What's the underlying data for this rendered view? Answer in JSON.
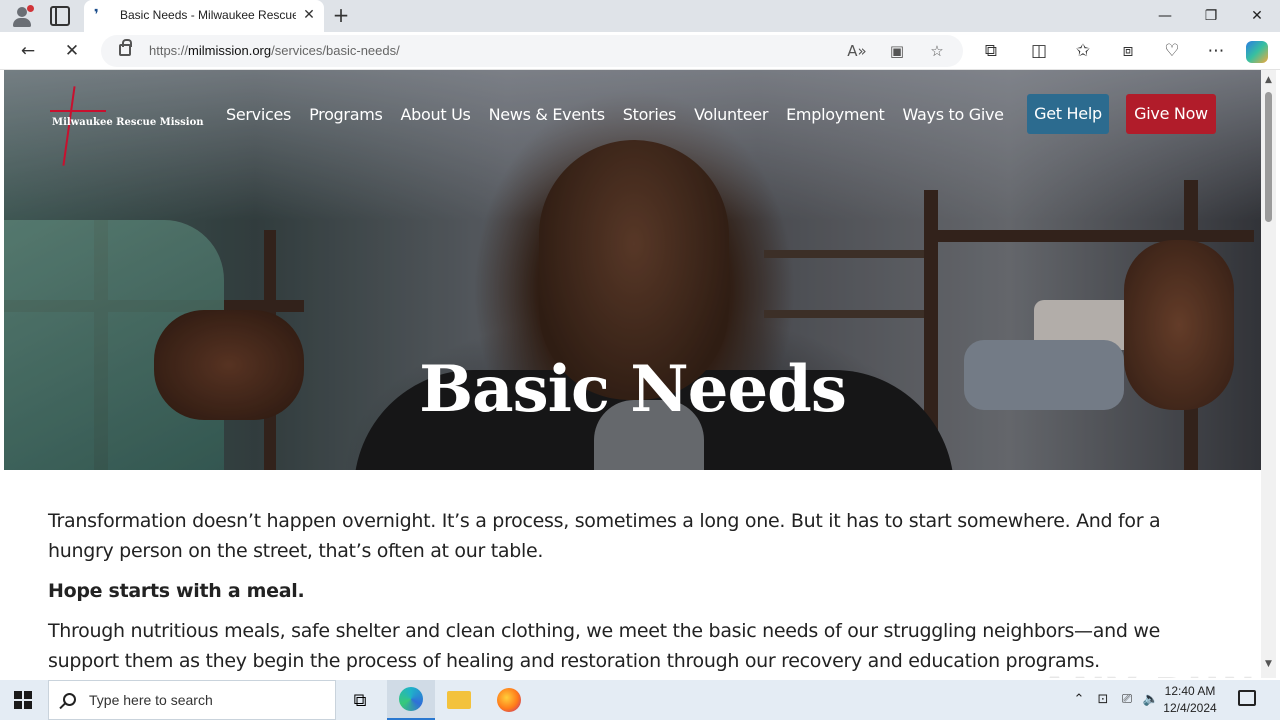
{
  "browser": {
    "tab_title": "Basic Needs - Milwaukee Rescue",
    "tab_close": "✕",
    "new_tab": "+",
    "url_scheme": "https://",
    "url_host": "milmission.org",
    "url_path": "/services/basic-needs/",
    "minimize": "—",
    "restore": "❐",
    "close": "✕"
  },
  "site": {
    "logo_text": "Milwaukee Rescue Mission",
    "nav": [
      "Services",
      "Programs",
      "About Us",
      "News & Events",
      "Stories",
      "Volunteer",
      "Employment",
      "Ways to Give"
    ],
    "get_help": "Get Help",
    "give_now": "Give Now",
    "hero_title": "Basic Needs",
    "paragraph_1": "Transformation doesn’t happen overnight. It’s a process, sometimes a long one. But it has to start somewhere. And for a hungry person on the street, that’s often at our table.",
    "heading": "Hope starts with a meal.",
    "paragraph_2": "Through nutritious meals, safe shelter and clean clothing, we meet the basic needs of our struggling neighbors—and we support them as they begin the process of healing and restoration through our recovery and education programs."
  },
  "watermark": "ANY RUN",
  "taskbar": {
    "search_placeholder": "Type here to search",
    "time": "12:40 AM",
    "date": "12/4/2024"
  },
  "colors": {
    "get_help_bg": "#2c6b8f",
    "give_now_bg": "#b11c2a",
    "logo_cross": "#c8102e"
  }
}
